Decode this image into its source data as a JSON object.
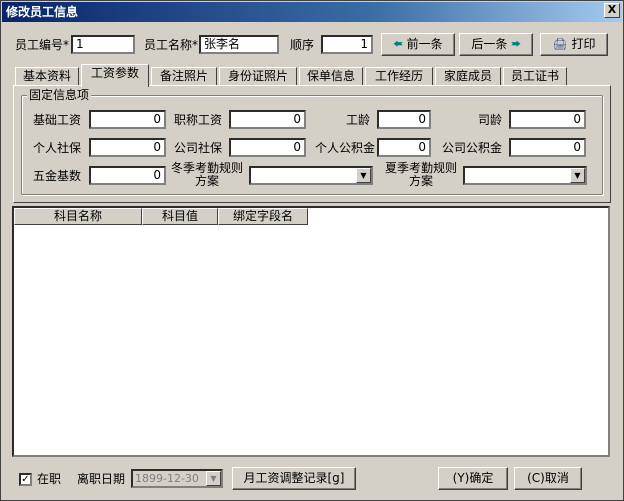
{
  "window": {
    "title": "修改员工信息",
    "close_glyph": "X"
  },
  "header": {
    "emp_no_label": "员工编号*",
    "emp_no_value": "1",
    "emp_name_label": "员工名称*",
    "emp_name_value": "张李名",
    "order_label": "顺序",
    "order_value": "1",
    "prev_label": "前一条",
    "next_label": "后一条",
    "print_label": "打印"
  },
  "tabs": [
    {
      "label": "基本资料"
    },
    {
      "label": "工资参数",
      "active": true
    },
    {
      "label": "备注照片"
    },
    {
      "label": "身份证照片"
    },
    {
      "label": "保单信息"
    },
    {
      "label": "工作经历"
    },
    {
      "label": "家庭成员"
    },
    {
      "label": "员工证书"
    }
  ],
  "fixed": {
    "group_title": "固定信息项",
    "base_salary_label": "基础工资",
    "base_salary": "0",
    "title_salary_label": "职称工资",
    "title_salary": "0",
    "seniority_label": "工龄",
    "seniority": "0",
    "company_age_label": "司龄",
    "company_age": "0",
    "personal_ss_label": "个人社保",
    "personal_ss": "0",
    "company_ss_label": "公司社保",
    "company_ss": "0",
    "personal_hf_label": "个人公积金",
    "personal_hf": "0",
    "company_hf_label": "公司公积金",
    "company_hf": "0",
    "insurance_base_label": "五金基数",
    "insurance_base": "0",
    "winter_rule_label_1": "冬季考勤规则",
    "winter_rule_label_2": "方案",
    "summer_rule_label_1": "夏季考勤规则",
    "summer_rule_label_2": "方案",
    "winter_rule_value": "",
    "summer_rule_value": ""
  },
  "grid": {
    "columns": [
      "科目名称",
      "科目值",
      "绑定字段名"
    ]
  },
  "footer": {
    "in_service_label": "在职",
    "in_service_checked": "✓",
    "leave_date_label": "离职日期",
    "leave_date_value": "1899-12-30",
    "adjust_button": "月工资调整记录[g]",
    "ok_button": "(Y)确定",
    "cancel_button": "(C)取消"
  }
}
